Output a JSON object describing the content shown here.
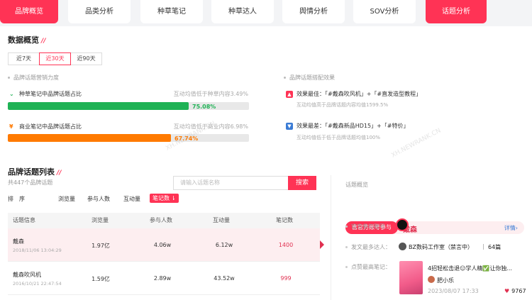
{
  "tabs": [
    "品牌概览",
    "品类分析",
    "种草笔记",
    "种草达人",
    "舆情分析",
    "SOV分析",
    "话题分析"
  ],
  "overview": {
    "title": "数据概览",
    "time_options": [
      "近7天",
      "近30天",
      "近90天"
    ],
    "selected_time": "近30天",
    "marketing_label": "品牌话题营销力度",
    "match_label": "品牌话题搭配效果",
    "metrics": [
      {
        "label": "种草笔记中品牌话题占比",
        "hint": "互动均值低于种草内容3.49%",
        "percent": "75.08%",
        "value": 0.7508,
        "color": "#1fb255"
      },
      {
        "label": "商业笔记中品牌话题占比",
        "hint": "互动均值低于商业内容6.98%",
        "percent": "67.74%",
        "value": 0.6774,
        "color": "#ff7a00"
      }
    ],
    "best": {
      "label": "效果最佳：「#戴森吹风机」+「#直发造型教程」",
      "sub": "互动均值高于品牌话题内容均值1599.5%"
    },
    "worst": {
      "label": "效果最差：「#戴森新品HD15」+「#特价」",
      "sub": "互动均值低于低于品牌话题均值100%"
    }
  },
  "list": {
    "title": "品牌话题列表",
    "count": "共447个品牌话题",
    "search_placeholder": "请输入话题名称",
    "search_button": "搜索",
    "sort_label": "排　序",
    "sort_options": [
      "浏览量",
      "参与人数",
      "互动量",
      "笔记数"
    ],
    "sort_active": "笔记数",
    "headers": [
      "话题信息",
      "浏览量",
      "参与人数",
      "互动量",
      "笔记数"
    ],
    "rows": [
      {
        "name": "戴森",
        "date": "2018/11/06 13:04:29",
        "views": "1.97亿",
        "people": "4.06w",
        "interact": "6.12w",
        "notes": "1400"
      },
      {
        "name": "戴森吹风机",
        "date": "2016/10/21 22:47:54",
        "views": "1.59亿",
        "people": "2.89w",
        "interact": "43.52w",
        "notes": "999"
      }
    ]
  },
  "detail": {
    "title": "话题概览",
    "official": "含官方账号参与",
    "brand": "戴森",
    "more": "详情›",
    "official_label": "官方参与账号：",
    "most_label": "发文最多达人：",
    "most_name": "BZ数码工作室（禁言中）",
    "most_count": "64篇",
    "top_label": "点赞最高笔记：",
    "top_title": "4招轻松击退😑学人精✅让你独...",
    "top_author": "肥小乐",
    "top_date": "2023/08/07 17:33",
    "top_likes": "9767",
    "heart_icon": "heart-icon"
  },
  "watermark": "XH.NEWRANK.CN"
}
